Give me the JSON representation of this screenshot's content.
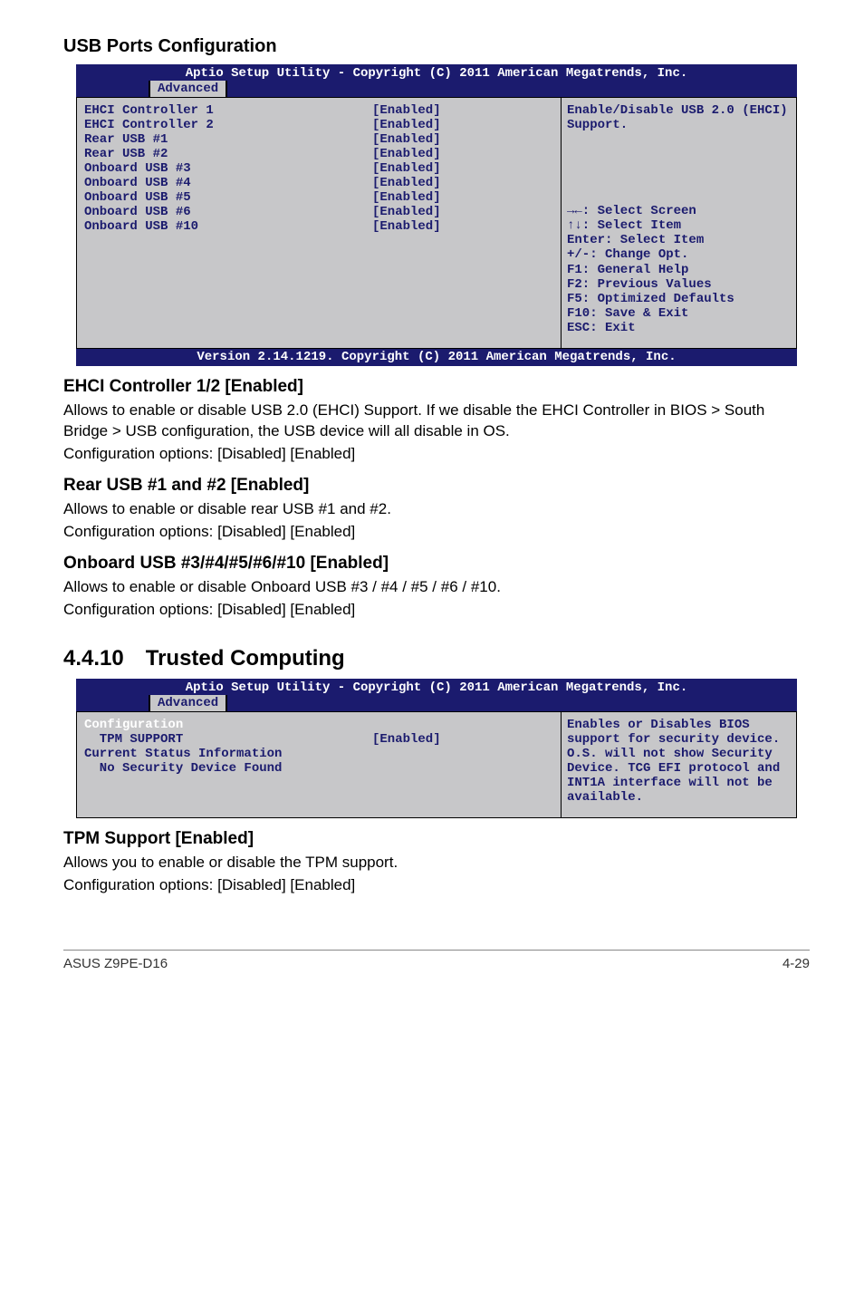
{
  "heading_usb": "USB Ports Configuration",
  "bios1": {
    "header": "Aptio Setup Utility - Copyright (C) 2011 American Megatrends, Inc.",
    "tab": "Advanced",
    "rows": [
      {
        "label": "EHCI Controller 1",
        "value": "[Enabled]"
      },
      {
        "label": "EHCI Controller 2",
        "value": "[Enabled]"
      },
      {
        "label": "",
        "value": ""
      },
      {
        "label": "",
        "value": ""
      },
      {
        "label": "Rear USB #1",
        "value": "[Enabled]"
      },
      {
        "label": "Rear USB #2",
        "value": "[Enabled]"
      },
      {
        "label": "Onboard USB #3",
        "value": "[Enabled]"
      },
      {
        "label": "Onboard USB #4",
        "value": "[Enabled]"
      },
      {
        "label": "Onboard USB #5",
        "value": "[Enabled]"
      },
      {
        "label": "Onboard USB #6",
        "value": "[Enabled]"
      },
      {
        "label": "Onboard USB #10",
        "value": "[Enabled]"
      }
    ],
    "help": "Enable/Disable USB 2.0 (EHCI) Support.",
    "nav": [
      "→←: Select Screen",
      "↑↓:  Select Item",
      "Enter: Select Item",
      "+/-: Change Opt.",
      "F1: General Help",
      "F2: Previous Values",
      "F5: Optimized Defaults",
      "F10: Save & Exit",
      "ESC: Exit"
    ],
    "footer": "Version 2.14.1219. Copyright (C) 2011 American Megatrends, Inc."
  },
  "ehci_heading": "EHCI Controller 1/2 [Enabled]",
  "ehci_p1": "Allows to enable or disable USB 2.0 (EHCI) Support. If we disable the EHCI Controller in BIOS > South Bridge > USB configuration, the USB device will all disable in OS.",
  "ehci_p2": "Configuration options: [Disabled] [Enabled]",
  "rear_heading": "Rear USB #1 and #2 [Enabled]",
  "rear_p1": "Allows to enable or disable rear USB #1 and #2.",
  "rear_p2": "Configuration options: [Disabled] [Enabled]",
  "onboard_heading": "Onboard USB #3/#4/#5/#6/#10 [Enabled]",
  "onboard_p1": "Allows to enable or disable Onboard USB #3 / #4 / #5 / #6 / #10.",
  "onboard_p2": "Configuration options: [Disabled] [Enabled]",
  "section_num": "4.4.10",
  "section_title": "Trusted Computing",
  "bios2": {
    "header": "Aptio Setup Utility - Copyright (C) 2011 American Megatrends, Inc.",
    "tab": "Advanced",
    "rows": [
      {
        "label": "Configuration",
        "value": "",
        "white": true
      },
      {
        "label": "  TPM SUPPORT",
        "value": "[Enabled]"
      },
      {
        "label": "",
        "value": ""
      },
      {
        "label": "Current Status Information",
        "value": ""
      },
      {
        "label": "  No Security Device Found",
        "value": ""
      }
    ],
    "help": "Enables or Disables BIOS support for security device. O.S. will not show Security Device. TCG EFI protocol and INT1A interface will not be available."
  },
  "tpm_heading": "TPM Support [Enabled]",
  "tpm_p1": "Allows you to enable or disable the TPM support.",
  "tpm_p2": "Configuration options: [Disabled] [Enabled]",
  "footer_left": "ASUS Z9PE-D16",
  "footer_right": "4-29"
}
